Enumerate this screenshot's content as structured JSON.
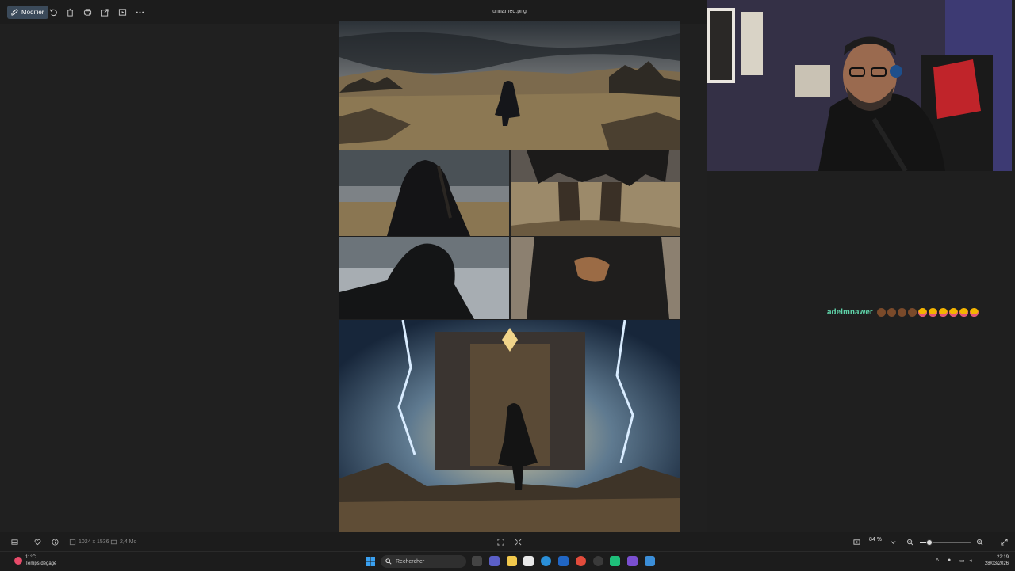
{
  "viewer": {
    "file_title": "unnamed.png",
    "toolbar": {
      "edit_label": "Modifier",
      "icons": [
        "rotate-icon",
        "delete-icon",
        "print-icon",
        "share-icon",
        "slideshow-icon",
        "more-icon"
      ]
    },
    "bottombar": {
      "dimensions": "1024 x 1536",
      "file_size": "2,4 Mo",
      "zoom": "84 %",
      "zoom_level_percent": 18
    }
  },
  "chat": {
    "username": "adelmnawer",
    "emotes": [
      "brown",
      "brown",
      "brown",
      "brown",
      "laugh",
      "laugh",
      "laugh",
      "laugh",
      "laugh",
      "laugh"
    ]
  },
  "taskbar": {
    "weather_temp": "11°C",
    "weather_desc": "Temps dégagé",
    "search_placeholder": "Rechercher",
    "time": "22:19",
    "date": "28/03/2026"
  },
  "colors": {
    "accent": "#3b4a5a",
    "chat_user": "#5fd3a9",
    "background": "#1f1f1f"
  }
}
